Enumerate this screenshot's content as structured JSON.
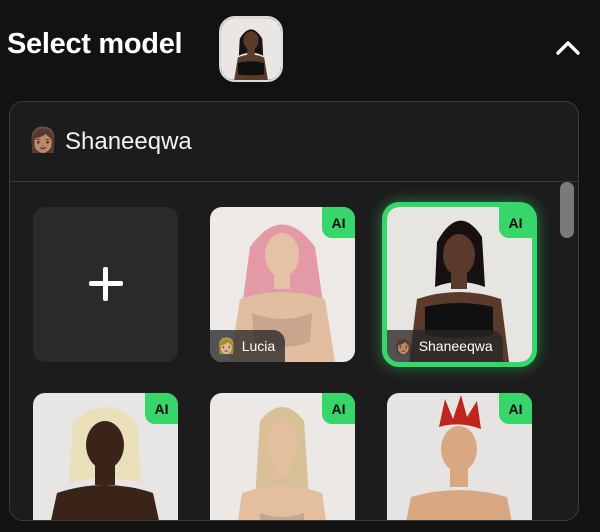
{
  "header": {
    "title": "Select model",
    "thumbnail_icon": "model-portrait-icon",
    "collapse_icon": "chevron-up-icon"
  },
  "selected": {
    "emoji": "👩🏽",
    "name": "Shaneeqwa"
  },
  "grid": {
    "add_label": "+",
    "models": [
      {
        "name": "Lucia",
        "emoji": "👩🏼",
        "badge": "AI",
        "show_name": true,
        "selected": false
      },
      {
        "name": "Shaneeqwa",
        "emoji": "👩🏽",
        "badge": "AI",
        "show_name": true,
        "selected": true
      },
      {
        "name": "",
        "emoji": "",
        "badge": "AI",
        "show_name": false,
        "selected": false
      },
      {
        "name": "",
        "emoji": "",
        "badge": "AI",
        "show_name": false,
        "selected": false
      },
      {
        "name": "",
        "emoji": "",
        "badge": "AI",
        "show_name": false,
        "selected": false
      }
    ]
  },
  "colors": {
    "accent_green": "#38d66a",
    "background": "#121212",
    "panel": "#1c1c1c"
  }
}
